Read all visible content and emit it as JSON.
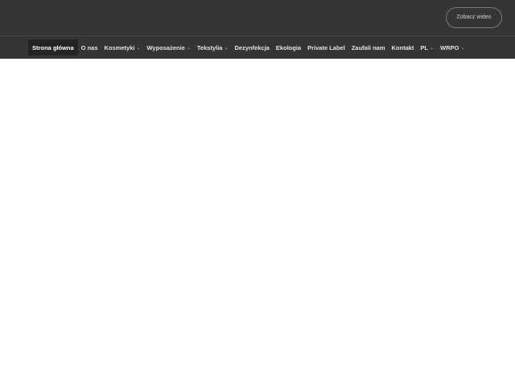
{
  "header": {
    "video_button_label": "Zobacz wideo"
  },
  "nav": {
    "items": [
      {
        "label": "Strona główna",
        "active": true
      },
      {
        "label": "O nas"
      },
      {
        "label": "Kosmetyki",
        "dropdown_icon": "chevron-down-icon"
      },
      {
        "label": "Wyposażenie",
        "dropdown_icon": "chevron-down-icon"
      },
      {
        "label": "Tekstylia",
        "dropdown_icon": "chevron-down-icon"
      },
      {
        "label": "Dezynfekcja"
      },
      {
        "label": "Ekologia"
      },
      {
        "label": "Private Label"
      },
      {
        "label": "Zaufali nam"
      },
      {
        "label": "Kontakt"
      },
      {
        "label": "PL",
        "dropdown_icon": "chevron-down-icon"
      },
      {
        "label": "WRPO",
        "dropdown_icon": "chevron-down-icon"
      }
    ],
    "chevron_glyph": "⌄"
  },
  "colors": {
    "header_bg": "#353535",
    "active_item_bg": "#232323",
    "page_bg": "#ffffff"
  }
}
